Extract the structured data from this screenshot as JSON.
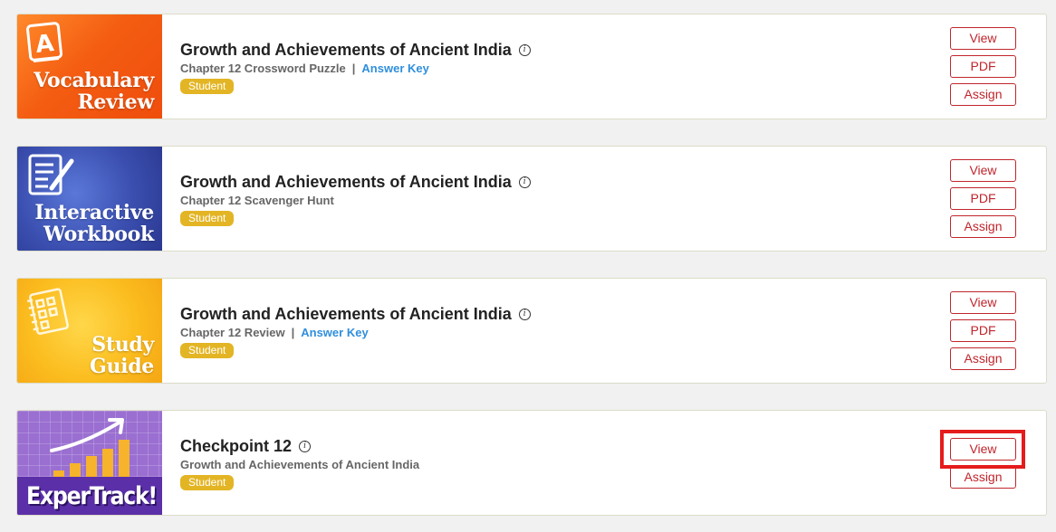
{
  "resources": [
    {
      "thumbnail_lines": [
        "Vocabulary",
        "Review"
      ],
      "thumbnail_icon": "letter-a-card-icon",
      "title": "Growth and Achievements of Ancient India",
      "subtitle": "Chapter 12 Crossword Puzzle",
      "link": "Answer Key",
      "badge": "Student",
      "buttons": [
        "View",
        "PDF",
        "Assign"
      ]
    },
    {
      "thumbnail_lines": [
        "Interactive",
        "Workbook"
      ],
      "thumbnail_icon": "document-pencil-icon",
      "title": "Growth and Achievements of Ancient India",
      "subtitle": "Chapter 12 Scavenger Hunt",
      "badge": "Student",
      "buttons": [
        "View",
        "PDF",
        "Assign"
      ]
    },
    {
      "thumbnail_lines": [
        "Study",
        "Guide"
      ],
      "thumbnail_icon": "checklist-notebook-icon",
      "title": "Growth and Achievements of Ancient India",
      "subtitle": "Chapter 12 Review",
      "link": "Answer Key",
      "badge": "Student",
      "buttons": [
        "View",
        "PDF",
        "Assign"
      ]
    },
    {
      "thumbnail_lines": [
        "ExperTrack!"
      ],
      "thumbnail_icon": "growth-chart-icon",
      "title": "Checkpoint 12",
      "subtitle": "Growth and Achievements of Ancient India",
      "badge": "Student",
      "buttons": [
        "View",
        "Assign"
      ]
    }
  ],
  "info_glyph": "i",
  "link_separator": "|",
  "colors": {
    "accent_red": "#c0252c",
    "link_blue": "#2f8fdc",
    "badge_gold": "#e3b525",
    "highlight_red": "#e51c1c"
  }
}
